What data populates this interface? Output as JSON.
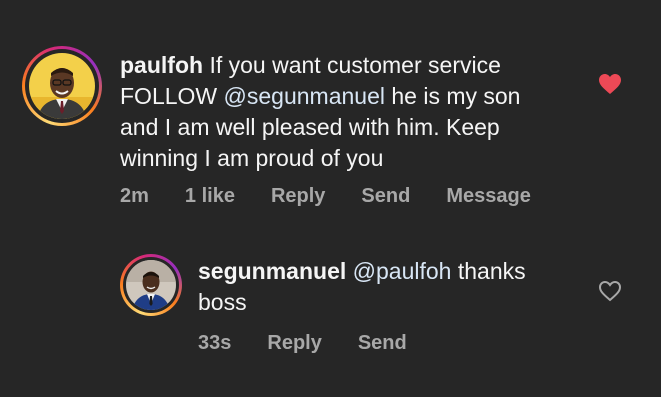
{
  "comments": [
    {
      "username": "paulfoh",
      "text_before": "If you want customer service FOLLOW ",
      "mention": "@segunmanuel",
      "text_after": " he is my son and I am well pleased with him. Keep winning I am proud of you",
      "time": "2m",
      "likes": "1 like",
      "reply": "Reply",
      "send": "Send",
      "message": "Message",
      "liked": true,
      "heart_color": "#ed4956",
      "heart_icon": "heart-filled-icon"
    },
    {
      "username": "segunmanuel",
      "mention": "@paulfoh",
      "text_after": " thanks boss",
      "time": "33s",
      "reply": "Reply",
      "send": "Send",
      "liked": false,
      "heart_icon": "heart-outline-icon"
    }
  ],
  "colors": {
    "background": "#262626",
    "text": "#f5f5f5",
    "meta": "#a8a8a8",
    "mention": "#d8e6f5"
  }
}
